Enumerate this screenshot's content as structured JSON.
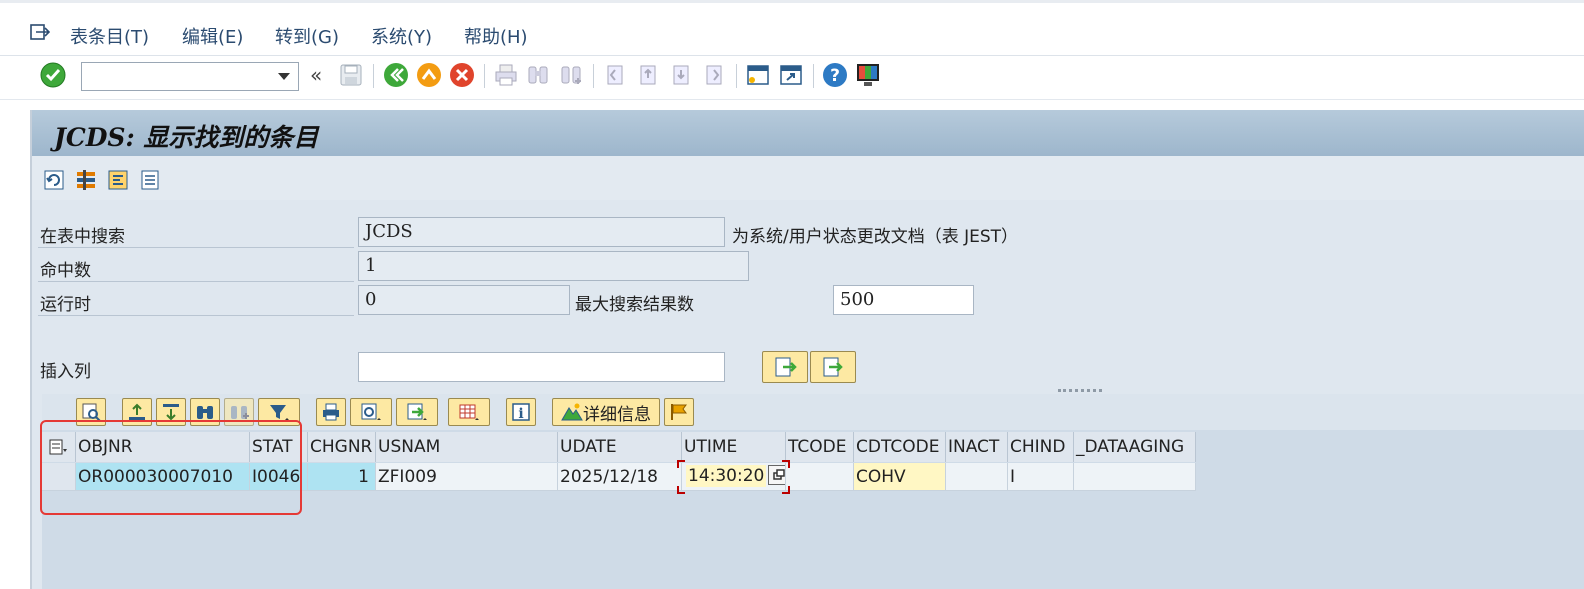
{
  "menubar": {
    "items": [
      "表条目(T)",
      "编辑(E)",
      "转到(G)",
      "系统(Y)",
      "帮助(H)"
    ]
  },
  "toolbar": {
    "command_field_value": "",
    "nav_back_label": "«"
  },
  "screen": {
    "title": "JCDS:  显示找到的条目"
  },
  "form": {
    "search_label": "在表中搜索",
    "search_table": "JCDS",
    "table_description": "为系统/用户状态更改文档（表 JEST）",
    "hits_label": "命中数",
    "hits_value": "1",
    "runtime_label": "运行时",
    "runtime_value": "0",
    "max_results_label": "最大搜索结果数",
    "max_results_value": "500",
    "insert_col_label": "插入列",
    "insert_col_value": ""
  },
  "alv": {
    "detail_button_label": "详细信息",
    "columns": [
      "OBJNR",
      "STAT",
      "CHGNR",
      "USNAM",
      "UDATE",
      "UTIME",
      "TCODE",
      "CDTCODE",
      "INACT",
      "CHIND",
      "_DATAAGING"
    ],
    "rows": [
      {
        "OBJNR": "OR000030007010",
        "STAT": "I0046",
        "CHGNR": "1",
        "USNAM": "ZFI009",
        "UDATE": "2025/12/18",
        "UTIME": "14:30:20",
        "TCODE": "",
        "CDTCODE": "COHV",
        "INACT": "",
        "CHIND": "I",
        "_DATAAGING": ""
      }
    ]
  },
  "colors": {
    "key_cell": "#aee3f2",
    "selected_cell": "#fff7c4",
    "highlight_box": "#e53935",
    "title_bar": "#a9c0d4"
  }
}
